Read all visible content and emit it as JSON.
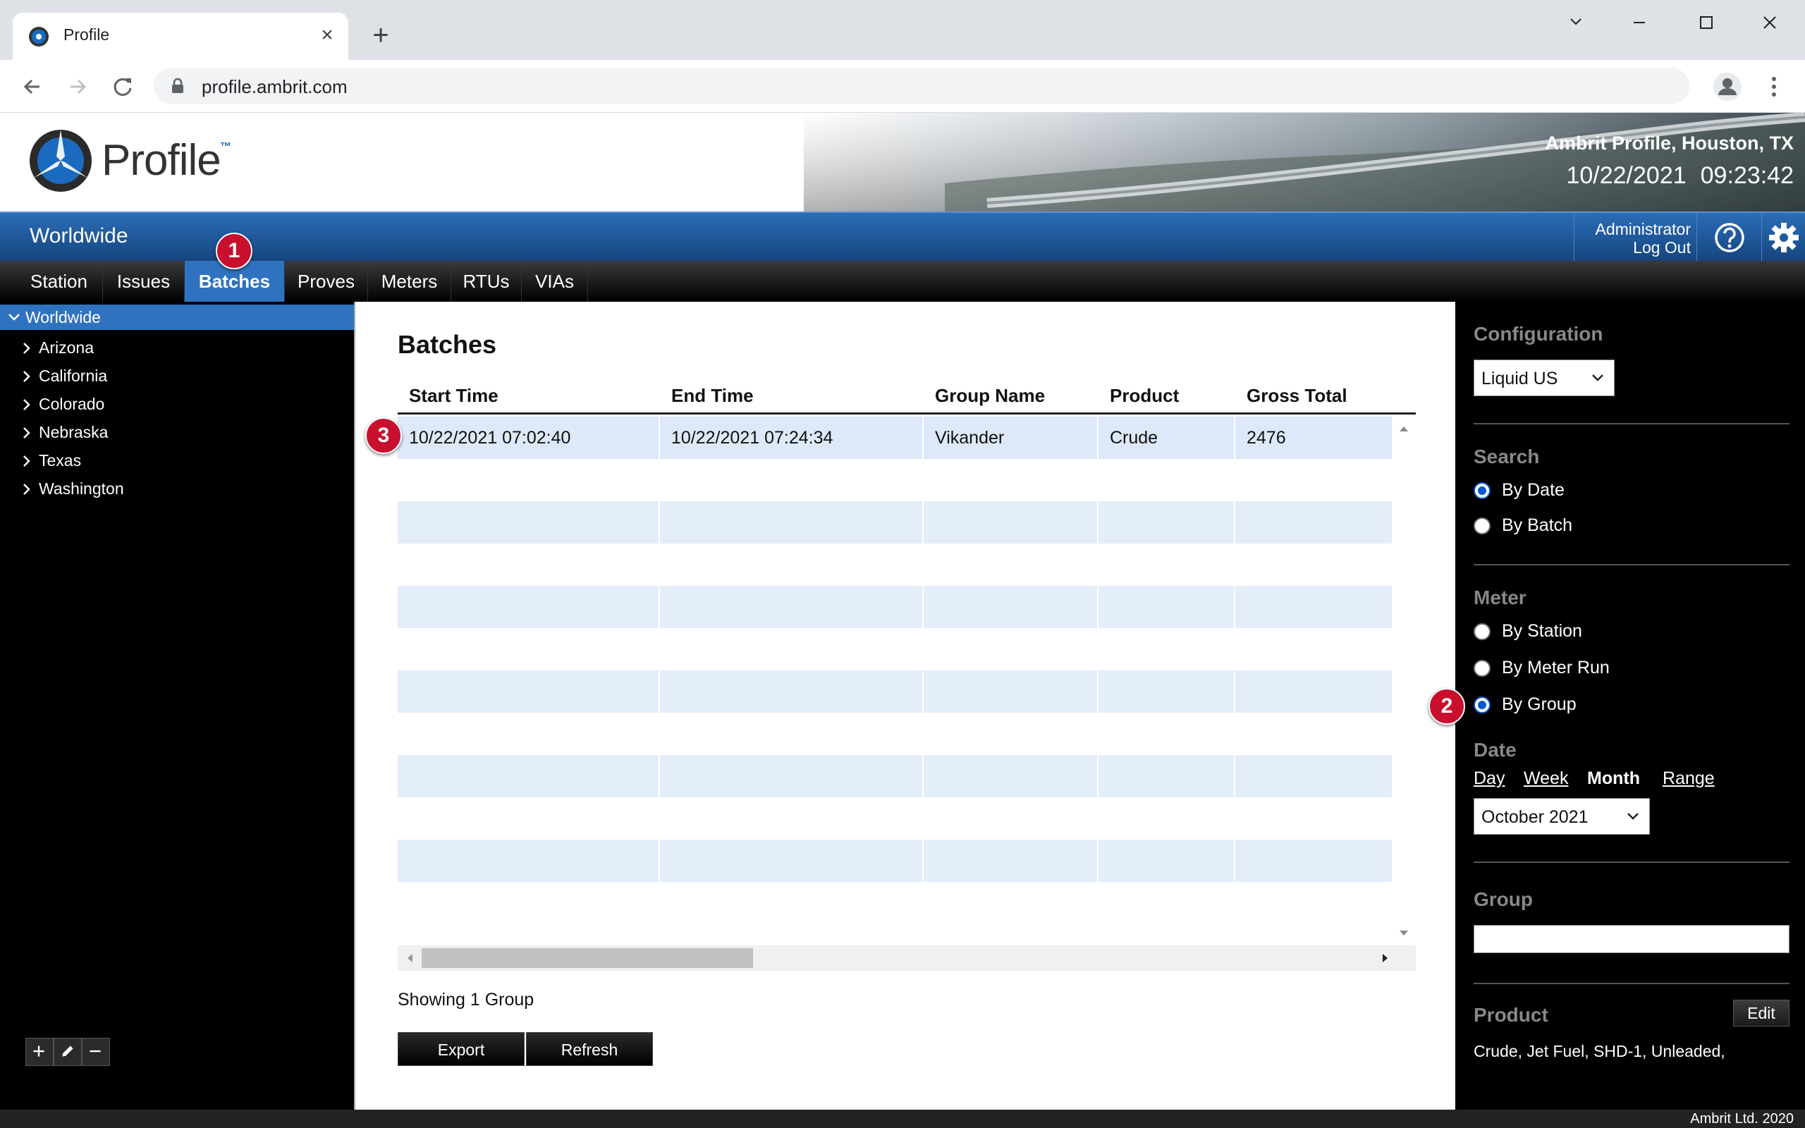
{
  "browser": {
    "tab_title": "Profile",
    "url": "profile.ambrit.com"
  },
  "header": {
    "logo_text": "Profile",
    "logo_tm": "™",
    "site_name": "Ambrit Profile, Houston, TX",
    "date": "10/22/2021",
    "time": "09:23:42"
  },
  "region": {
    "title": "Worldwide",
    "user": "Administrator",
    "logout": "Log Out"
  },
  "main_tabs": [
    "Station",
    "Issues",
    "Batches",
    "Proves",
    "Meters",
    "RTUs",
    "VIAs"
  ],
  "active_tab": "Batches",
  "tree": {
    "root": "Worldwide",
    "items": [
      "Arizona",
      "California",
      "Colorado",
      "Nebraska",
      "Texas",
      "Washington"
    ]
  },
  "content": {
    "title": "Batches",
    "columns": [
      "Start Time",
      "End Time",
      "Group Name",
      "Product",
      "Gross Total"
    ],
    "rows": [
      [
        "10/22/2021 07:02:40",
        "10/22/2021 07:24:34",
        "Vikander",
        "Crude",
        "2476"
      ]
    ],
    "status": "Showing 1 Group",
    "export_label": "Export",
    "refresh_label": "Refresh"
  },
  "sidebar": {
    "configuration_label": "Configuration",
    "configuration_value": "Liquid US",
    "search_label": "Search",
    "search_options": [
      "By Date",
      "By Batch"
    ],
    "search_selected": "By Date",
    "meter_label": "Meter",
    "meter_options": [
      "By Station",
      "By Meter Run",
      "By Group"
    ],
    "meter_selected": "By Group",
    "date_label": "Date",
    "date_modes": [
      "Day",
      "Week",
      "Month",
      "Range"
    ],
    "date_mode_selected": "Month",
    "date_value": "October 2021",
    "group_label": "Group",
    "group_value": "",
    "product_label": "Product",
    "edit_label": "Edit",
    "product_list": "Crude, Jet Fuel, SHD-1, Unleaded,"
  },
  "footer": "Ambrit Ltd. 2020",
  "markers": [
    "1",
    "2",
    "3"
  ],
  "colors": {
    "accent_blue": "#2f72bf",
    "marker_red": "#c8102e",
    "row_alt": "#e4edfa"
  }
}
